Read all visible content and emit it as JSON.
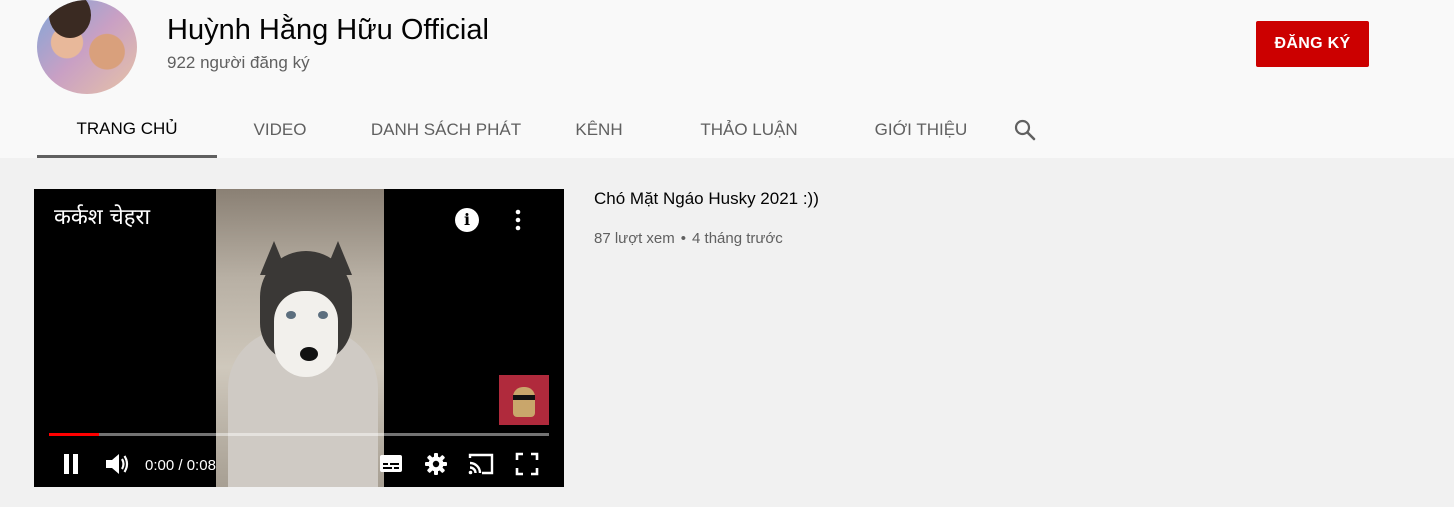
{
  "channel": {
    "name": "Huỳnh Hằng Hữu Official",
    "subscribers": "922 người đăng ký",
    "subscribe_label": "ĐĂNG KÝ",
    "accent_color": "#cc0000"
  },
  "tabs": [
    {
      "label": "TRANG CHỦ",
      "active": true
    },
    {
      "label": "VIDEO",
      "active": false
    },
    {
      "label": "DANH SÁCH PHÁT",
      "active": false
    },
    {
      "label": "KÊNH",
      "active": false
    },
    {
      "label": "THẢO LUẬN",
      "active": false
    },
    {
      "label": "GIỚI THIỆU",
      "active": false
    }
  ],
  "search_icon": "search-icon",
  "player": {
    "overlay_title": "कर्कश चेहरा",
    "time_current": "0:00",
    "time_separator": " / ",
    "time_total": "0:08",
    "progress": 0.1,
    "icons": [
      "info-icon",
      "more-vert-icon",
      "pause-icon",
      "volume-icon",
      "captions-icon",
      "settings-icon",
      "cast-icon",
      "fullscreen-icon"
    ]
  },
  "video": {
    "title": "Chó Mặt Ngáo Husky 2021 :))",
    "views": "87 lượt xem",
    "separator": "•",
    "age": "4 tháng trước"
  }
}
